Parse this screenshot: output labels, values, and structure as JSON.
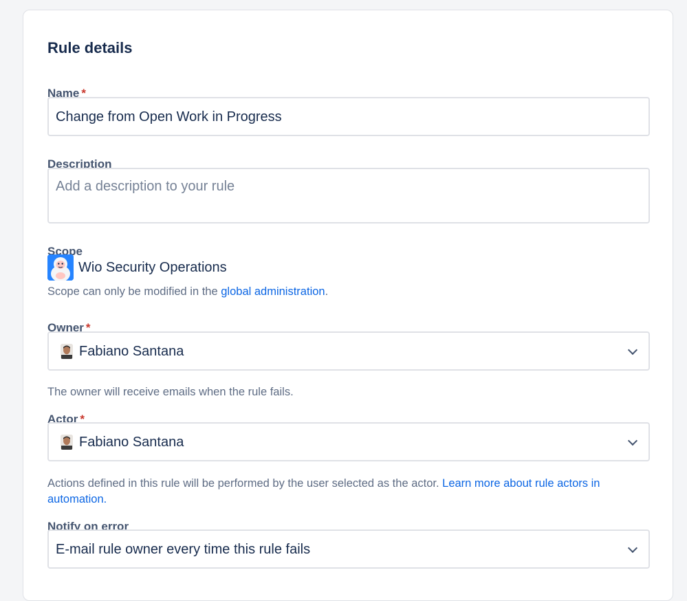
{
  "rule_details": {
    "title": "Rule details",
    "name": {
      "label": "Name",
      "required": "*",
      "value": "Change from Open Work in Progress"
    },
    "description": {
      "label": "Description",
      "placeholder": "Add a description to your rule"
    },
    "scope": {
      "label": "Scope",
      "project_name": "Wio Security Operations",
      "icon": "yeti-project-icon",
      "help_prefix": "Scope can only be modified in the ",
      "help_link": "global administration",
      "help_suffix": "."
    },
    "owner": {
      "label": "Owner",
      "required": "*",
      "value": "Fabiano Santana",
      "avatar": "user-avatar",
      "help": "The owner will receive emails when the rule fails."
    },
    "actor": {
      "label": "Actor",
      "required": "*",
      "value": "Fabiano Santana",
      "avatar": "user-avatar",
      "help_prefix": "Actions defined in this rule will be performed by the user selected as the actor. ",
      "help_link": "Learn more about rule actors in automation."
    },
    "notify": {
      "label": "Notify on error",
      "value": "E-mail rule owner every time this rule fails"
    }
  },
  "colors": {
    "link": "#0c66e4",
    "required": "#c9372c",
    "scope_icon_bg": "#2684ff"
  }
}
